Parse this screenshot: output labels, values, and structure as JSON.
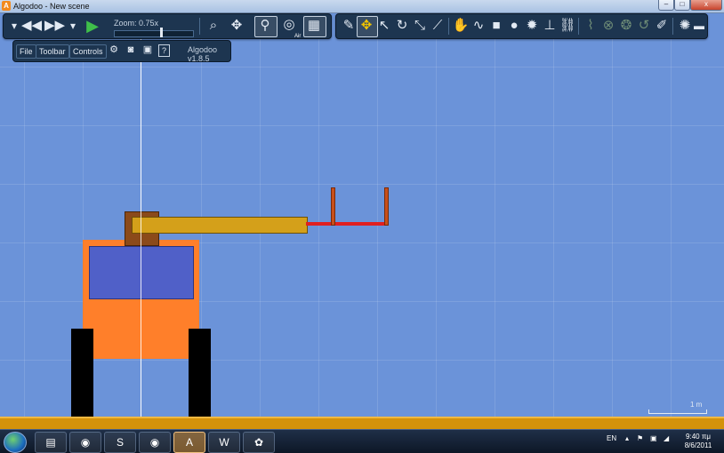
{
  "window": {
    "app_icon_letter": "A",
    "title": "Algodoo - New scene",
    "controls": {
      "minimize": "–",
      "maximize": "□",
      "close": "x"
    }
  },
  "toolbar_left": {
    "menu_icon": "menu-dropdown-icon",
    "rewind_icon": "rewind-icon",
    "fast_forward_icon": "fast-forward-icon",
    "play_icon": "play-icon",
    "zoom_label": "Zoom: 0.75x",
    "zoom_level": 0.6,
    "zoom_tool_icon": "magnifier-icon",
    "pan_tool_icon": "move-icon",
    "gravity_icon": "gravity-icon",
    "air_label": "Air",
    "grid_icon": "grid-icon"
  },
  "toolbar_sub": {
    "file_label": "File",
    "toolbar_label": "Toolbar",
    "controls_label": "Controls",
    "version": "Algodoo v1.8.5"
  },
  "toolbar_right": {
    "icons": [
      "sketch-icon",
      "move-tool-icon",
      "drag-icon",
      "rotate-icon",
      "scale-icon",
      "knife-icon",
      "grab-icon",
      "rope-icon",
      "box-icon",
      "circle-icon",
      "gear-icon",
      "fixate-icon",
      "chain-icon",
      "spring-icon",
      "hinge-icon",
      "axle-icon",
      "motor-icon",
      "pen-icon",
      "tracer-icon",
      "eraser-icon"
    ]
  },
  "scene": {
    "scale_label": "1 m",
    "colors": {
      "background": "#6b93d9",
      "body": "#ff7f2a",
      "window": "#5060c8",
      "arm": "#d4a01a",
      "joint": "#8b4a1a",
      "legs": "#000000",
      "claw_bar": "#e02020",
      "claw_fingers": "#c8501a",
      "floor": "#d4920a"
    }
  },
  "taskbar": {
    "lang": "EN",
    "time": "9:40 πμ",
    "date": "8/6/2011",
    "apps": [
      "explorer-icon",
      "firefox-icon",
      "skype-icon",
      "firefox-icon",
      "algodoo-icon",
      "word-icon",
      "paint-icon"
    ]
  }
}
